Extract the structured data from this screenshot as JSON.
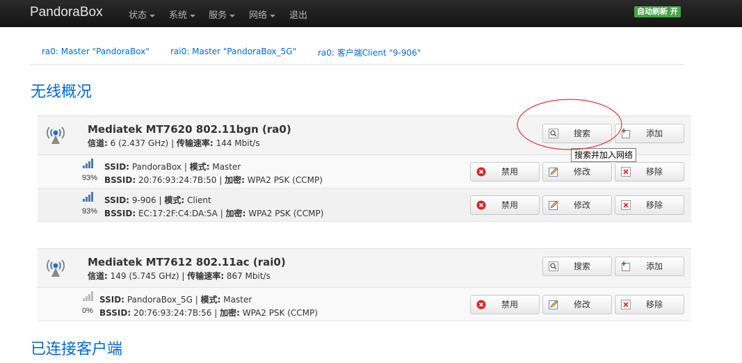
{
  "navbar": {
    "brand": "PandoraBox",
    "items": [
      "状态",
      "系统",
      "服务",
      "网络",
      "退出"
    ],
    "autorefresh": "自动刷新 开"
  },
  "tabs": [
    "ra0: Master \"PandoraBox\"",
    "rai0: Master \"PandoraBox_5G\"",
    "ra0: 客户端Client \"9-906\""
  ],
  "section_overview": "无线概况",
  "section_clients": "已连接客户端",
  "labels": {
    "channel": "信道:",
    "rate": "传输速率:",
    "ssid": "SSID:",
    "mode": "模式:",
    "bssid": "BSSID:",
    "encryption": "加密:"
  },
  "buttons": {
    "scan": "搜索",
    "add": "添加",
    "disable": "禁用",
    "edit": "修改",
    "remove": "移除"
  },
  "tooltip": "搜索并加入网络",
  "devices": [
    {
      "name": "Mediatek MT7620 802.11bgn (ra0)",
      "channel": "6 (2.437 GHz)",
      "rate": "144 Mbit/s",
      "networks": [
        {
          "signal": "93%",
          "signal_level": 0.93,
          "ssid": "PandoraBox",
          "mode": "Master",
          "bssid": "20:76:93:24:7B:50",
          "encryption": "WPA2 PSK (CCMP)"
        },
        {
          "signal": "93%",
          "signal_level": 0.93,
          "ssid": "9-906",
          "mode": "Client",
          "bssid": "EC:17:2F:C4:DA:5A",
          "encryption": "WPA2 PSK (CCMP)"
        }
      ]
    },
    {
      "name": "Mediatek MT7612 802.11ac (rai0)",
      "channel": "149 (5.745 GHz)",
      "rate": "867 Mbit/s",
      "networks": [
        {
          "signal": "0%",
          "signal_level": 0,
          "ssid": "PandoraBox_5G",
          "mode": "Master",
          "bssid": "20:76:93:24:7B:56",
          "encryption": "WPA2 PSK (CCMP)"
        }
      ]
    }
  ],
  "colors": {
    "link": "#0069d6",
    "navbar": "#1b1b1b",
    "autorefresh": "#46a546",
    "annotation": "#d9363e"
  }
}
